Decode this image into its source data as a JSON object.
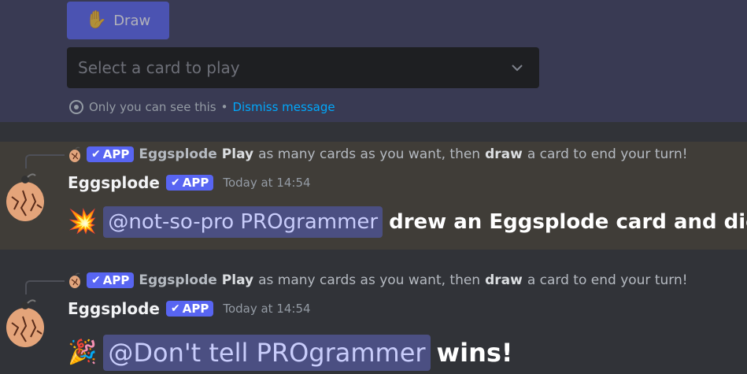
{
  "ephemeral": {
    "draw_label": "Draw",
    "select_placeholder": "Select a card to play",
    "only_you": "Only you can see this",
    "separator": "•",
    "dismiss": "Dismiss message"
  },
  "messages": [
    {
      "reply": {
        "tag": "APP",
        "name": "Eggsplode",
        "text_1": "Play",
        "text_2": "as many cards as you want, then",
        "text_3": "draw",
        "text_4": "a card to end your turn!"
      },
      "author": "Eggsplode",
      "tag": "APP",
      "timestamp": "Today at 14:54",
      "emoji": "💥",
      "mention": "@not-so-pro PROgrammer",
      "text": "drew an Eggsplode card and died!"
    },
    {
      "reply": {
        "tag": "APP",
        "name": "Eggsplode",
        "text_1": "Play",
        "text_2": "as many cards as you want, then",
        "text_3": "draw",
        "text_4": "a card to end your turn!"
      },
      "author": "Eggsplode",
      "tag": "APP",
      "timestamp": "Today at 14:54",
      "emoji": "🎉",
      "mention": "@Don't tell PROgrammer",
      "text": "wins!"
    }
  ],
  "colors": {
    "blurple": "#5865f2",
    "link": "#00a8fc",
    "highlight_bg": "#403d38",
    "mention_bg": "#4b4f82"
  },
  "icons": [
    "hand-icon",
    "chevron-down-icon",
    "eye-icon",
    "check-icon",
    "egg-avatar-icon",
    "explosion-emoji-icon",
    "party-popper-emoji-icon"
  ]
}
